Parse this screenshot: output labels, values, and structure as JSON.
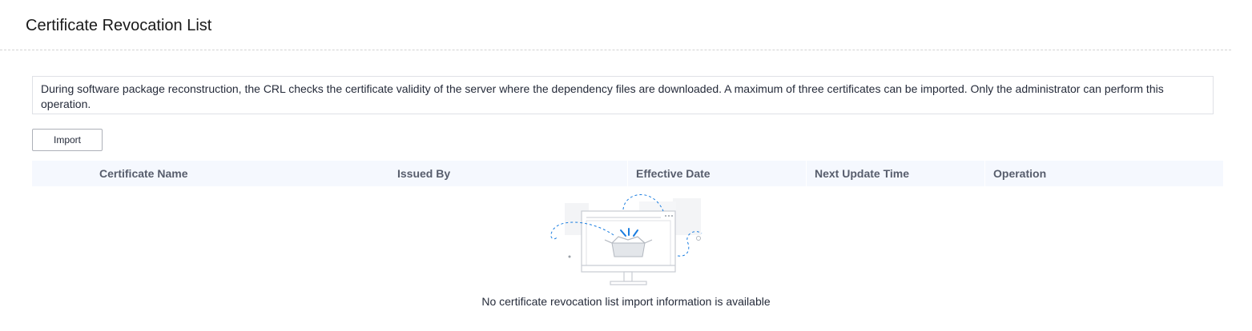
{
  "page": {
    "title": "Certificate Revocation List"
  },
  "info": {
    "text": "During software package reconstruction, the CRL checks the certificate validity of the server where the dependency files are downloaded. A maximum of three certificates can be imported. Only the administrator can perform this operation."
  },
  "toolbar": {
    "import_label": "Import"
  },
  "table": {
    "columns": [
      {
        "label": ""
      },
      {
        "label": "Certificate Name"
      },
      {
        "label": "Issued By"
      },
      {
        "label": "Effective Date"
      },
      {
        "label": "Next Update Time"
      },
      {
        "label": "Operation"
      }
    ],
    "rows": [],
    "empty_message": "No certificate revocation list import information is available"
  },
  "colors": {
    "header_background": "#f5f8fe",
    "accent_blue": "#1a7de0",
    "text": "#252b3a"
  },
  "icons": {
    "empty_state": "empty-box-monitor-icon"
  }
}
